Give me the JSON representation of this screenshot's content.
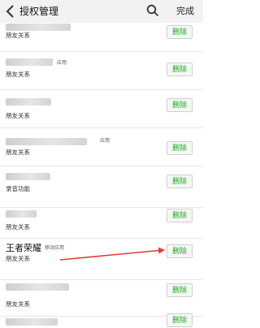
{
  "header": {
    "title": "授权管理",
    "done_label": "完成"
  },
  "delete_label": "删除",
  "items": [
    {
      "name": "",
      "tag": "",
      "description": "朋友关系"
    },
    {
      "name": "",
      "tag": "应用",
      "description": "朋友关系"
    },
    {
      "name": "",
      "tag": "",
      "description": "朋友关系"
    },
    {
      "name": "",
      "tag": "应用",
      "description": "朋友关系"
    },
    {
      "name": "",
      "tag": "",
      "description": "录音功能"
    },
    {
      "name": "",
      "tag": "",
      "description": "朋友关系"
    },
    {
      "name": "王者荣耀",
      "tag": "移动应用",
      "description": "朋友关系"
    },
    {
      "name": "",
      "tag": "",
      "description": "朋友关系"
    },
    {
      "name": "",
      "tag": "",
      "description": ""
    }
  ],
  "colors": {
    "accent": "#1aad19",
    "arrow": "#e53935",
    "header_bg": "#f2f2f2"
  }
}
